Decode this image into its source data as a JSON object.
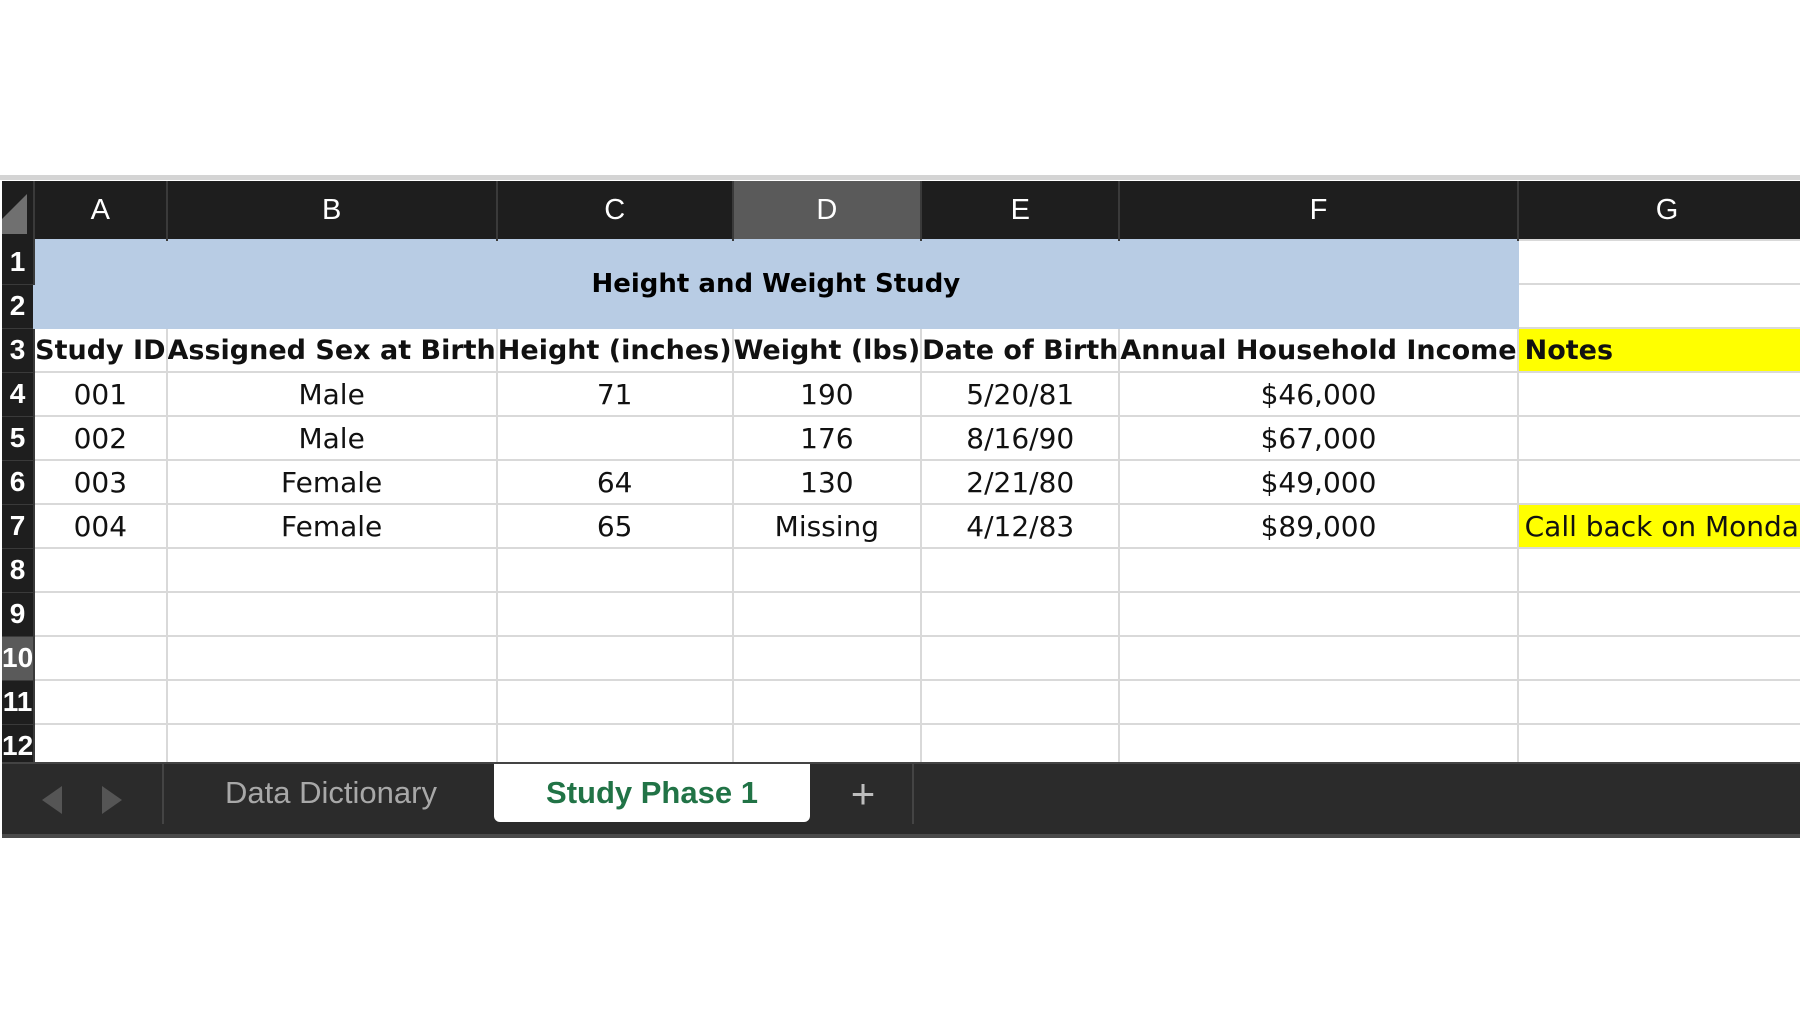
{
  "columns": [
    "A",
    "B",
    "C",
    "D",
    "E",
    "F",
    "G"
  ],
  "selected_column": "D",
  "rows": [
    "1",
    "2",
    "3",
    "4",
    "5",
    "6",
    "7",
    "8",
    "9",
    "10",
    "11",
    "12"
  ],
  "selected_row": "10",
  "title": "Height and Weight Study",
  "headers": [
    "Study ID",
    "Assigned Sex at Birth",
    "Height (inches)",
    "Weight (lbs)",
    "Date of Birth",
    "Annual Household Income",
    "Notes"
  ],
  "data": [
    [
      "001",
      "Male",
      "71",
      "190",
      "5/20/81",
      "$46,000",
      ""
    ],
    [
      "002",
      "Male",
      "",
      "176",
      "8/16/90",
      "$67,000",
      ""
    ],
    [
      "003",
      "Female",
      "64",
      "130",
      "2/21/80",
      "$49,000",
      ""
    ],
    [
      "004",
      "Female",
      "65",
      "Missing",
      "4/12/83",
      "$89,000",
      "Call back on Monday"
    ]
  ],
  "colors": {
    "title_fill": "#b8cce4",
    "note_fill": "#ffff00",
    "active_tab_text": "#217346"
  },
  "tabs": [
    {
      "label": "Data Dictionary",
      "active": false
    },
    {
      "label": "Study Phase 1",
      "active": true
    }
  ],
  "icons": {
    "prev": "triangle-left-icon",
    "next": "triangle-right-icon",
    "add": "plus-icon"
  },
  "add_tab_glyph": "+"
}
